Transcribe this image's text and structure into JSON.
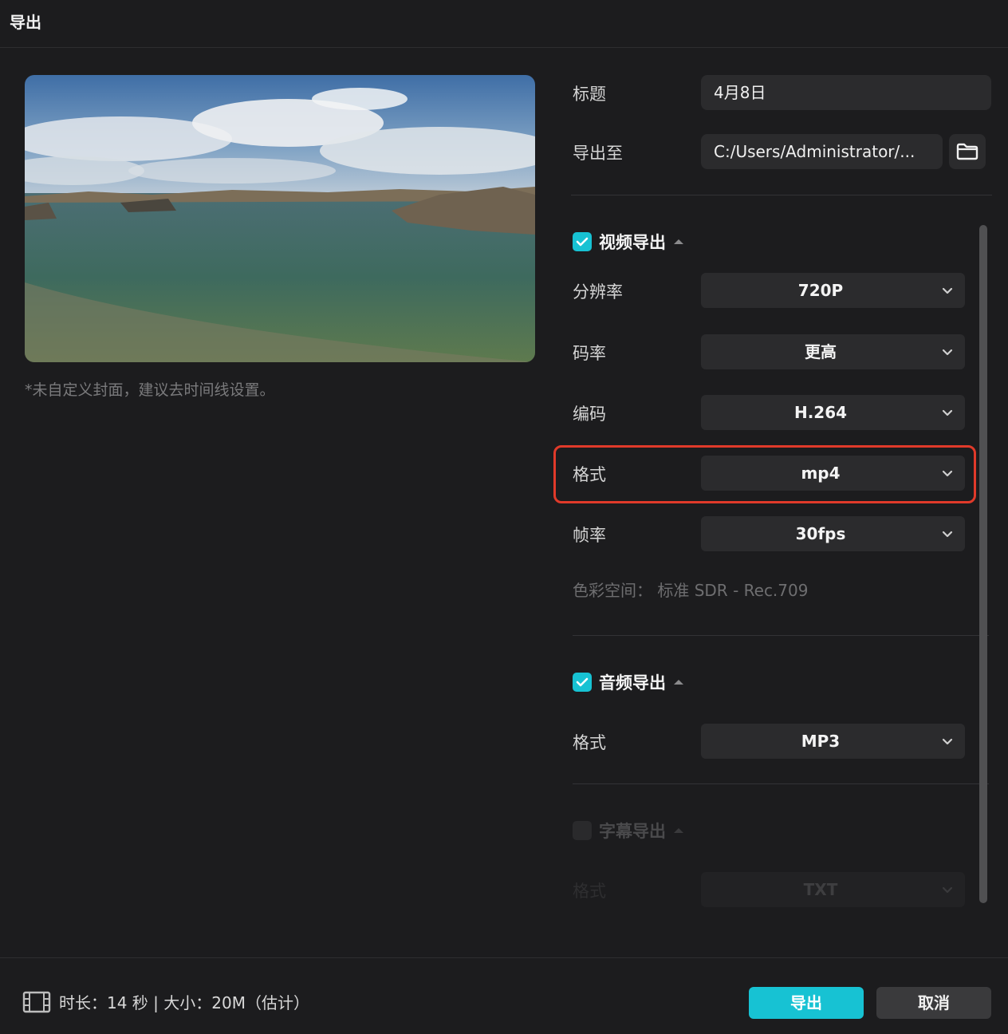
{
  "window": {
    "title": "导出"
  },
  "preview": {
    "cover_hint": "*未自定义封面，建议去时间线设置。"
  },
  "general": {
    "title_label": "标题",
    "title_value": "4月8日",
    "export_to_label": "导出至",
    "export_to_value": "C:/Users/Administrator/..."
  },
  "video": {
    "section_label": "视频导出",
    "enabled": true,
    "resolution_label": "分辨率",
    "resolution_value": "720P",
    "bitrate_label": "码率",
    "bitrate_value": "更高",
    "codec_label": "编码",
    "codec_value": "H.264",
    "format_label": "格式",
    "format_value": "mp4",
    "framerate_label": "帧率",
    "framerate_value": "30fps",
    "color_space": "色彩空间：  标准 SDR - Rec.709"
  },
  "audio": {
    "section_label": "音频导出",
    "enabled": true,
    "format_label": "格式",
    "format_value": "MP3"
  },
  "subtitle": {
    "section_label": "字幕导出",
    "enabled": false,
    "format_label": "格式",
    "format_value": "TXT"
  },
  "footer": {
    "info": "时长：14 秒 | 大小：20M（估计）",
    "export_button": "导出",
    "cancel_button": "取消"
  },
  "colors": {
    "accent": "#17c2d3",
    "highlight": "#e03a2a",
    "background": "#1c1c1e"
  }
}
